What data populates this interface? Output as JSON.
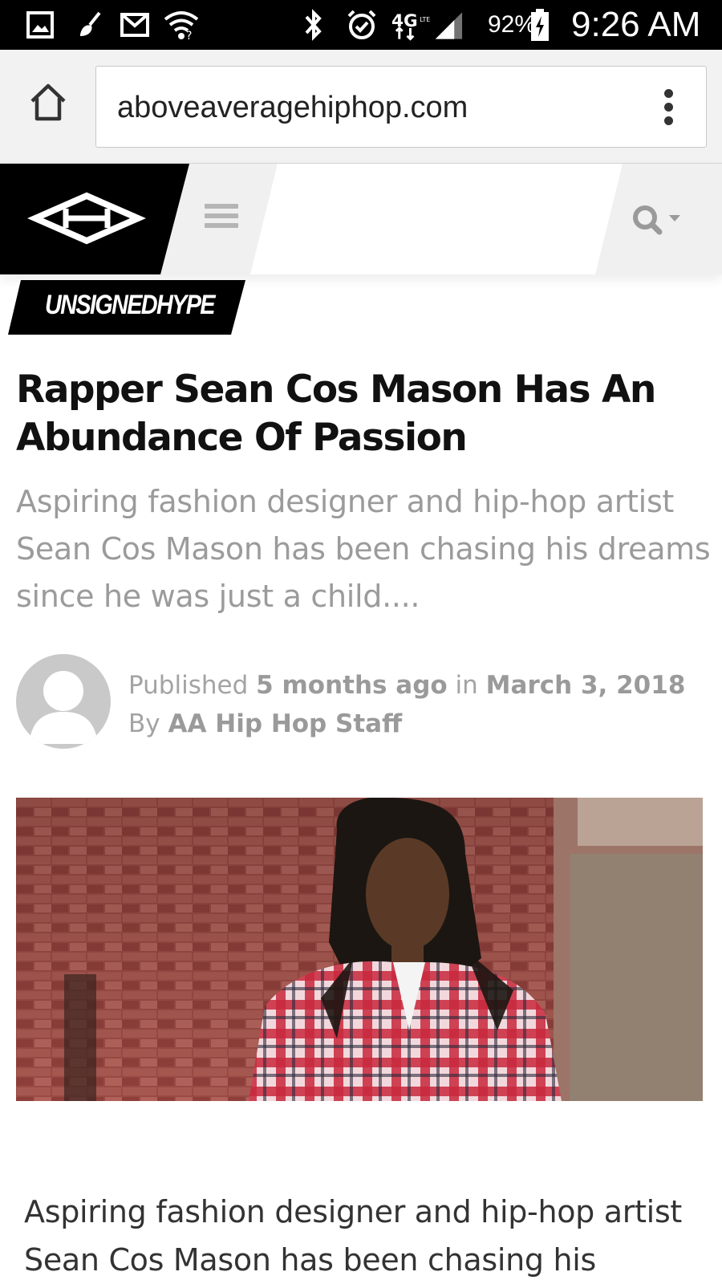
{
  "status_bar": {
    "battery_percent": "92%",
    "time": "9:26 AM",
    "network": "4G",
    "icons": [
      "gallery-icon",
      "cleaner-icon",
      "gmail-icon",
      "wifi-icon",
      "bluetooth-icon",
      "alarm-icon",
      "signal-icon",
      "battery-icon"
    ]
  },
  "browser": {
    "url": "aboveaveragehiphop.com",
    "home_icon": "home-icon",
    "menu_icon": "overflow-menu-icon"
  },
  "site_header": {
    "logo_icon": "site-logo-icon",
    "menu_icon": "hamburger-icon",
    "search_icon": "search-icon",
    "dropdown_icon": "caret-down-icon"
  },
  "article": {
    "category": "UNSIGNEDHYPE",
    "title": "Rapper Sean Cos Mason Has An Abundance Of Passion",
    "excerpt": "Aspiring fashion designer and hip-hop artist Sean Cos Mason has been chasing his dreams since he was just a child....",
    "meta": {
      "published_prefix": "Published",
      "relative_time": "5 months ago",
      "in_word": "in",
      "date": "March 3, 2018",
      "by_word": "By",
      "author": "AA Hip Hop Staff"
    },
    "body_start": "Aspiring fashion designer and hip-hop artist Sean Cos Mason has been chasing his"
  },
  "colors": {
    "status_bar_bg": "#000000",
    "browser_bg": "#f2f2f2",
    "header_bg": "#f0f0f0",
    "title": "#111111",
    "excerpt": "#9b9b9b",
    "accent": "#000000"
  }
}
